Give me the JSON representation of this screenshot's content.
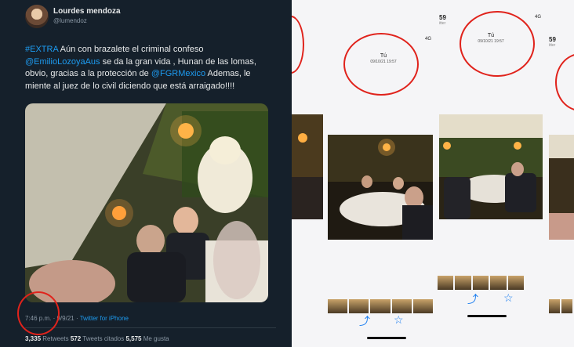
{
  "tweet": {
    "display_name": "Lourdes mendoza",
    "handle": "@lumendoz",
    "text": [
      {
        "t": "#EXTRA",
        "link": true
      },
      {
        "t": " Aún con brazalete el criminal confeso ",
        "link": false
      },
      {
        "t": "@EmilioLozoyaAus",
        "link": true
      },
      {
        "t": " se da la gran vida , Hunan de las lomas, obvio, gracias a la protección de ",
        "link": false
      },
      {
        "t": "@FGRMexico",
        "link": true
      },
      {
        "t": " Ademas, le miente al juez de lo civil diciendo que está arraigado!!!!",
        "link": false
      }
    ],
    "time": "7:46 p.m.",
    "date": "9/9/21",
    "source": "Twitter for iPhone",
    "retweets": "3,335",
    "retweets_label": "Retweets",
    "quotes": "572",
    "quotes_label": "Tweets citados",
    "likes": "5,575",
    "likes_label": "Me gusta"
  },
  "phone_panels": [
    {
      "time": "",
      "status_right": "4G",
      "header_title": "Tú",
      "header_date": "09/10/21 19:57"
    },
    {
      "time": "59",
      "sub": "itter",
      "status_right": "4G",
      "header_title": "Tú",
      "header_date": "09/10/21 19:57"
    },
    {
      "time": "59",
      "sub": "itter",
      "status_right": "4G",
      "header_title": "",
      "header_date": ""
    }
  ],
  "colors": {
    "tweet_bg": "#15202b",
    "link": "#1d9bf0",
    "annotation": "#e0231c",
    "ios_blue": "#1d7ff0"
  },
  "icons": [
    "share-icon",
    "star-icon",
    "signal-icon"
  ]
}
